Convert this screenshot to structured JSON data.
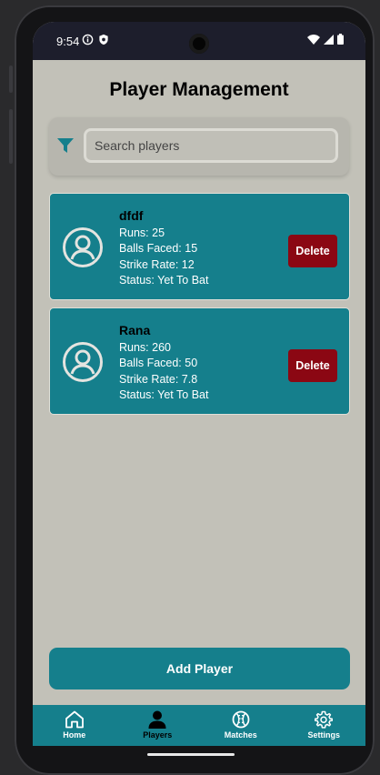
{
  "status_bar": {
    "time": "9:54"
  },
  "page": {
    "title": "Player Management"
  },
  "search": {
    "placeholder": "Search players"
  },
  "players": [
    {
      "name": "dfdf",
      "runs": "Runs: 25",
      "balls_faced": "Balls Faced: 15",
      "strike_rate": "Strike Rate: 12",
      "status": "Status: Yet To Bat",
      "delete_label": "Delete"
    },
    {
      "name": "Rana",
      "runs": "Runs: 260",
      "balls_faced": "Balls Faced: 50",
      "strike_rate": "Strike Rate: 7.8",
      "status": "Status: Yet To Bat",
      "delete_label": "Delete"
    }
  ],
  "add_button": {
    "label": "Add Player"
  },
  "nav": {
    "items": [
      {
        "label": "Home",
        "icon": "home-icon",
        "active": false
      },
      {
        "label": "Players",
        "icon": "person-icon",
        "active": true
      },
      {
        "label": "Matches",
        "icon": "baseball-icon",
        "active": false
      },
      {
        "label": "Settings",
        "icon": "gear-icon",
        "active": false
      }
    ]
  },
  "colors": {
    "accent": "#157f8c",
    "danger": "#8b0713",
    "background": "#c2c1b8",
    "status_bar": "#1d1e2c"
  }
}
